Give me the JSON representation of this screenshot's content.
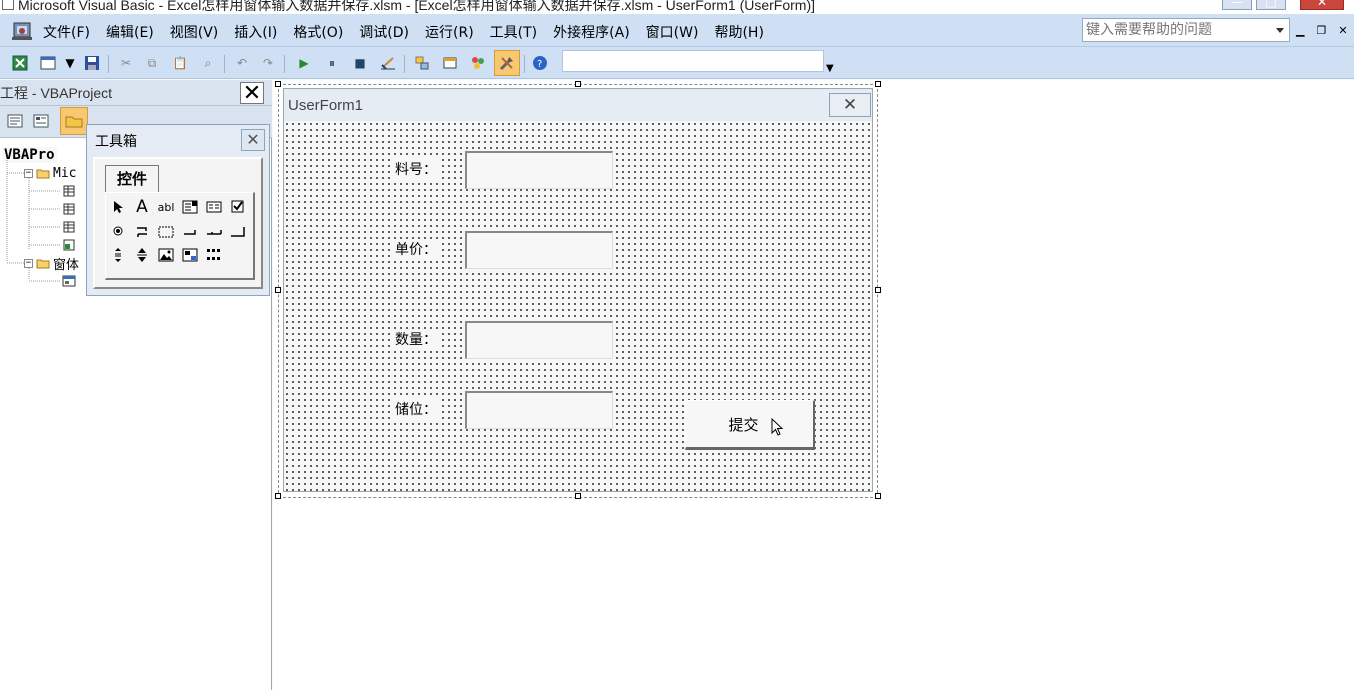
{
  "window": {
    "title": "Microsoft Visual Basic - Excel怎样用窗体输入数据并保存.xlsm - [Excel怎样用窗体输入数据并保存.xlsm - UserForm1 (UserForm)]"
  },
  "menubar": {
    "items": [
      "文件(F)",
      "编辑(E)",
      "视图(V)",
      "插入(I)",
      "格式(O)",
      "调试(D)",
      "运行(R)",
      "工具(T)",
      "外接程序(A)",
      "窗口(W)",
      "帮助(H)"
    ],
    "help_placeholder": "键入需要帮助的问题"
  },
  "project": {
    "title": "工程 - VBAProject",
    "tree": {
      "root": "VBAPro",
      "folder1": "Mic",
      "folder2": "窗体"
    }
  },
  "toolbox": {
    "title": "工具箱",
    "tab": "控件",
    "tools": [
      "pointer-icon",
      "label-tool-icon",
      "textbox-tool-icon",
      "combobox-tool-icon",
      "listbox-tool-icon",
      "checkbox-tool-icon",
      "optionbutton-tool-icon",
      "togglebutton-tool-icon",
      "frame-tool-icon",
      "commandbutton-tool-icon",
      "tabstrip-tool-icon",
      "multipage-tool-icon",
      "scrollbar-tool-icon",
      "spinbutton-tool-icon",
      "image-tool-icon",
      "refedit-tool-icon",
      "more-controls-icon"
    ],
    "glyphs": {
      "label": "A",
      "textbox": "abl"
    }
  },
  "form": {
    "title": "UserForm1",
    "labels": {
      "part_no": "料号：",
      "unit_price": "单价：",
      "quantity": "数量：",
      "location": "储位："
    },
    "submit_label": "提交"
  },
  "colors": {
    "menubar_bg": "#cfe0f5",
    "highlight": "#f8c870",
    "close_red": "#c9463d"
  }
}
